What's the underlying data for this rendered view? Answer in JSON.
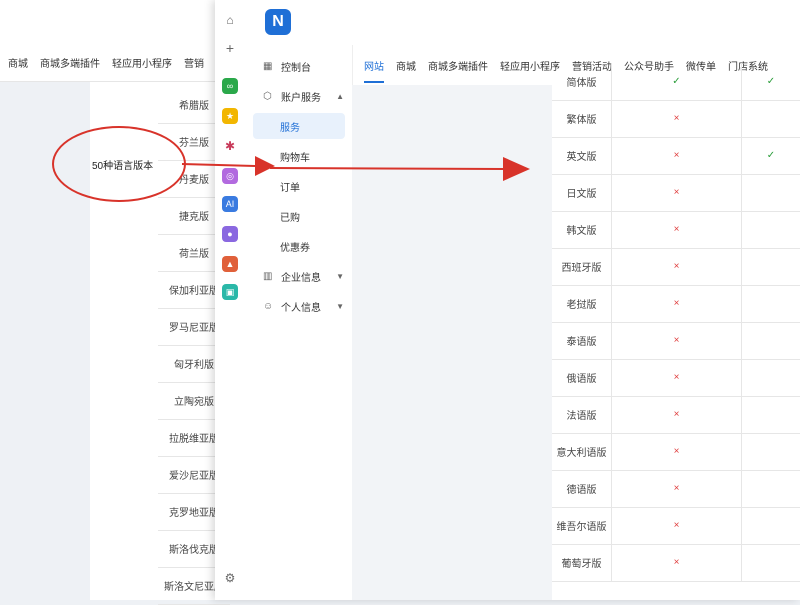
{
  "background_window": {
    "nav_items": [
      "商城",
      "商城多端插件",
      "轻应用小程序",
      "营销"
    ],
    "rows": [
      "希腊版",
      "芬兰版",
      "丹麦版",
      "捷克版",
      "荷兰版",
      "保加利亚版",
      "罗马尼亚版",
      "匈牙利版",
      "立陶宛版",
      "拉脱维亚版",
      "爱沙尼亚版",
      "克罗地亚版",
      "斯洛伐克版",
      "斯洛文尼亚版"
    ]
  },
  "annotation": {
    "label": "50种语言版本"
  },
  "app": {
    "logo_letter": "N",
    "sidebar": {
      "items": [
        {
          "label": "控制台",
          "icon": "grid-icon"
        },
        {
          "label": "账户服务",
          "icon": "box-icon",
          "expanded": true
        },
        {
          "label": "服务",
          "active": true
        },
        {
          "label": "购物车"
        },
        {
          "label": "订单"
        },
        {
          "label": "已购"
        },
        {
          "label": "优惠券"
        },
        {
          "label": "企业信息",
          "icon": "building-icon"
        },
        {
          "label": "个人信息",
          "icon": "user-icon"
        }
      ]
    },
    "topnav": [
      "网站",
      "商城",
      "商城多端插件",
      "轻应用小程序",
      "营销活动",
      "公众号助手",
      "微传单",
      "门店系统"
    ],
    "table_rows": [
      {
        "name": "简体版",
        "mark1": "✓",
        "mark2": "✓"
      },
      {
        "name": "繁体版",
        "mark1": "×",
        "mark2": ""
      },
      {
        "name": "英文版",
        "mark1": "×",
        "mark2": "✓"
      },
      {
        "name": "日文版",
        "mark1": "×",
        "mark2": ""
      },
      {
        "name": "韩文版",
        "mark1": "×",
        "mark2": ""
      },
      {
        "name": "西班牙版",
        "mark1": "×",
        "mark2": ""
      },
      {
        "name": "老挝版",
        "mark1": "×",
        "mark2": ""
      },
      {
        "name": "泰语版",
        "mark1": "×",
        "mark2": ""
      },
      {
        "name": "俄语版",
        "mark1": "×",
        "mark2": ""
      },
      {
        "name": "法语版",
        "mark1": "×",
        "mark2": ""
      },
      {
        "name": "意大利语版",
        "mark1": "×",
        "mark2": ""
      },
      {
        "name": "德语版",
        "mark1": "×",
        "mark2": ""
      },
      {
        "name": "维吾尔语版",
        "mark1": "×",
        "mark2": ""
      },
      {
        "name": "葡萄牙版",
        "mark1": "×",
        "mark2": ""
      }
    ],
    "colors": {
      "accent": "#1f6fd6",
      "annotation": "#d8332a",
      "cross": "#e04040",
      "check": "#2a9d3a"
    }
  }
}
